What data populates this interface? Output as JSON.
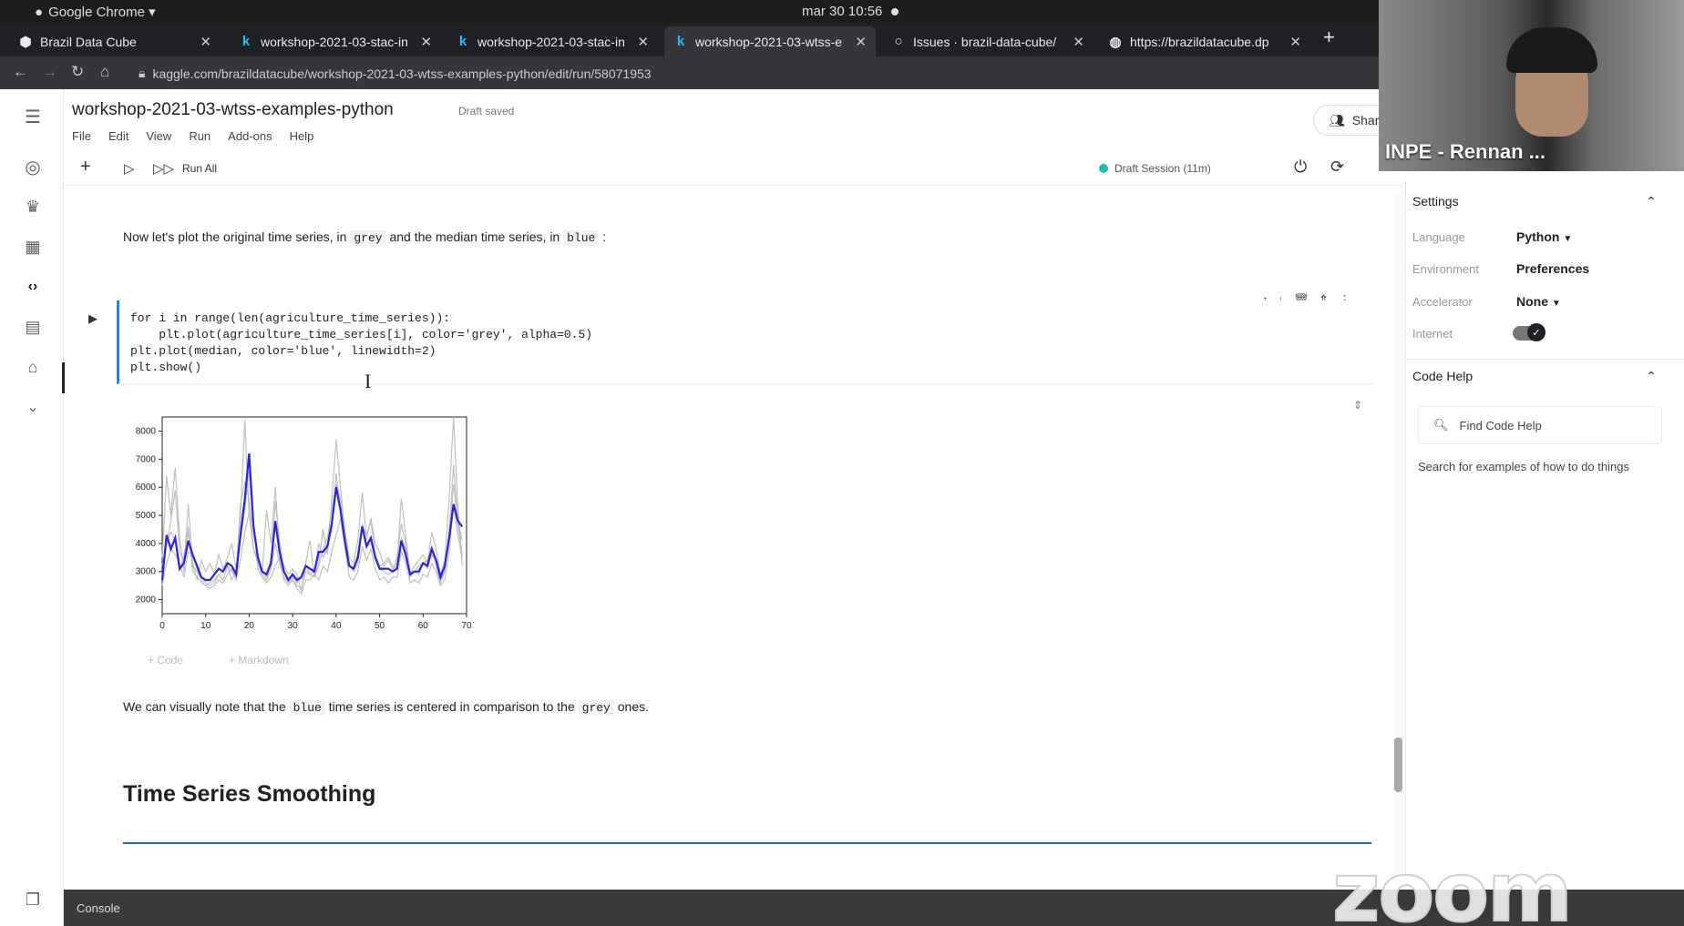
{
  "os": {
    "app": "Google Chrome ▾",
    "clock": "mar 30  10:56"
  },
  "tabs": [
    {
      "title": "Brazil Data Cube",
      "icon": "bdc-icon"
    },
    {
      "title": "workshop-2021-03-stac-in",
      "icon": "kaggle-icon"
    },
    {
      "title": "workshop-2021-03-stac-in",
      "icon": "kaggle-icon"
    },
    {
      "title": "workshop-2021-03-wtss-e",
      "icon": "kaggle-icon"
    },
    {
      "title": "Issues · brazil-data-cube/",
      "icon": "github-icon"
    },
    {
      "title": "https://brazildatacube.dp",
      "icon": "globe-icon"
    }
  ],
  "address": {
    "url": "kaggle.com/brazildatacube/workshop-2021-03-wtss-examples-python/edit/run/58071953"
  },
  "notebook": {
    "title": "workshop-2021-03-wtss-examples-python",
    "status": "Draft saved",
    "menu": [
      "File",
      "Edit",
      "View",
      "Run",
      "Add-ons",
      "Help"
    ],
    "run_all": "Run All",
    "session": "Draft Session (11m)",
    "share": "Shar"
  },
  "cells": {
    "md1": {
      "pre": "Now let's plot the original time series, in ",
      "c1": "grey",
      "mid": " and the median time series, in ",
      "c2": "blue",
      "post": " :"
    },
    "code": [
      "for i in range(len(agriculture_time_series)):",
      "    plt.plot(agriculture_time_series[i], color='grey', alpha=0.5)",
      "plt.plot(median, color='blue', linewidth=2)",
      "plt.show()"
    ],
    "add_code": "+ Code",
    "add_markdown": "+ Markdown",
    "md2": {
      "pre": "We can visually note that the ",
      "c1": "blue",
      "mid": " time series is centered in comparison to the ",
      "c2": "grey",
      "post": " ones."
    },
    "heading": "Time Series Smoothing"
  },
  "panel": {
    "settings": "Settings",
    "language_label": "Language",
    "language": "Python",
    "environment_label": "Environment",
    "environment": "Preferences",
    "accelerator_label": "Accelerator",
    "accelerator": "None",
    "internet_label": "Internet",
    "code_help": "Code Help",
    "find_placeholder": "Find Code Help",
    "hint": "Search for examples of how to do things"
  },
  "console": "Console",
  "video": {
    "name": "INPE - Rennan ...",
    "watermark": "zoom"
  },
  "colors": {
    "accent": "#1e6ed1",
    "median": "#2b22e0",
    "grey_series": "#b5b5b5"
  },
  "chart_data": {
    "type": "line",
    "xlim": [
      0,
      70
    ],
    "ylim": [
      1500,
      8500
    ],
    "xticks": [
      0,
      10,
      20,
      30,
      40,
      50,
      60,
      70
    ],
    "yticks": [
      2000,
      3000,
      4000,
      5000,
      6000,
      7000,
      8000
    ],
    "series": [
      {
        "color": "grey",
        "values": [
          3500,
          6400,
          5000,
          6700,
          4200,
          3000,
          5400,
          3300,
          2700,
          3400,
          3000,
          3300,
          2900,
          3600,
          3100,
          3500,
          4000,
          3100,
          5000,
          8400,
          5000,
          3800,
          3300,
          2900,
          5200,
          4000,
          6000,
          3700,
          3200,
          2900,
          3100,
          2900,
          2300,
          3300,
          4100,
          2800,
          3300,
          4500,
          3600,
          5600,
          7700,
          6000,
          4500,
          3500,
          3300,
          4100,
          5800,
          4200,
          4900,
          4000,
          3700,
          3200,
          3400,
          3100,
          3300,
          5600,
          4300,
          2900,
          3200,
          3400,
          3600,
          3300,
          4400,
          3800,
          2900,
          3400,
          5600,
          8500,
          5300,
          3200
        ]
      },
      {
        "color": "grey",
        "values": [
          2800,
          4000,
          4400,
          4100,
          3000,
          3600,
          4400,
          3200,
          3000,
          2800,
          2600,
          2500,
          2600,
          2900,
          3000,
          3200,
          2700,
          3000,
          4200,
          5200,
          6600,
          4400,
          3600,
          3000,
          2800,
          3100,
          4000,
          3300,
          2800,
          2600,
          2800,
          2600,
          2800,
          3200,
          2900,
          3000,
          4000,
          3500,
          3800,
          4500,
          6500,
          5200,
          3900,
          3200,
          3100,
          3600,
          4700,
          3900,
          4000,
          3600,
          3100,
          3000,
          2900,
          3000,
          3500,
          4700,
          4000,
          3000,
          3000,
          3200,
          3300,
          3100,
          3600,
          3400,
          2700,
          3000,
          4300,
          6800,
          4700,
          3600
        ]
      },
      {
        "color": "grey",
        "values": [
          3200,
          3900,
          4800,
          5900,
          3700,
          3400,
          4600,
          3000,
          2800,
          2600,
          2500,
          2600,
          2700,
          2900,
          2700,
          3200,
          3000,
          2800,
          5400,
          6200,
          5600,
          3800,
          3400,
          2900,
          2700,
          3100,
          5500,
          4100,
          3000,
          2600,
          2700,
          2500,
          2400,
          3000,
          2900,
          2800,
          3200,
          3800,
          4200,
          5200,
          6100,
          5600,
          4400,
          3300,
          3000,
          3300,
          4600,
          4300,
          4800,
          3600,
          3200,
          3300,
          3500,
          3200,
          3100,
          4200,
          3800,
          2800,
          3000,
          2900,
          3300,
          3400,
          3900,
          3200,
          2600,
          3000,
          4400,
          6100,
          4800,
          4100
        ]
      },
      {
        "color": "grey",
        "values": [
          2500,
          3300,
          3800,
          3600,
          3300,
          2800,
          3700,
          3600,
          3100,
          2700,
          2500,
          2400,
          2500,
          2700,
          2600,
          2900,
          3100,
          2700,
          3400,
          4400,
          5100,
          4700,
          3100,
          2800,
          2600,
          2800,
          3200,
          3500,
          2700,
          2500,
          2700,
          2400,
          2200,
          2700,
          2700,
          2900,
          2700,
          3200,
          3000,
          3700,
          4300,
          4900,
          3900,
          2800,
          2700,
          3000,
          3900,
          3400,
          3800,
          3100,
          2700,
          2800,
          2600,
          2800,
          2800,
          3700,
          3300,
          2600,
          2700,
          2600,
          2900,
          2800,
          3300,
          3000,
          2500,
          2700,
          3700,
          5400,
          4300,
          3500
        ]
      },
      {
        "color": "blue",
        "values": [
          2700,
          4300,
          3800,
          4200,
          3100,
          3300,
          4100,
          3600,
          3200,
          2800,
          2700,
          2700,
          2900,
          3100,
          3000,
          3300,
          3200,
          2900,
          4300,
          5600,
          7200,
          4600,
          3500,
          3000,
          2900,
          3300,
          4800,
          3700,
          3000,
          2700,
          2900,
          2700,
          2800,
          3200,
          3100,
          3000,
          3700,
          3700,
          3900,
          4700,
          6000,
          5200,
          4100,
          3200,
          3100,
          3500,
          4600,
          3900,
          4200,
          3500,
          3100,
          3100,
          3100,
          3000,
          3100,
          4100,
          3600,
          2900,
          3000,
          3000,
          3300,
          3200,
          3800,
          3400,
          2800,
          3200,
          4200,
          5400,
          4800,
          4600
        ]
      }
    ]
  }
}
